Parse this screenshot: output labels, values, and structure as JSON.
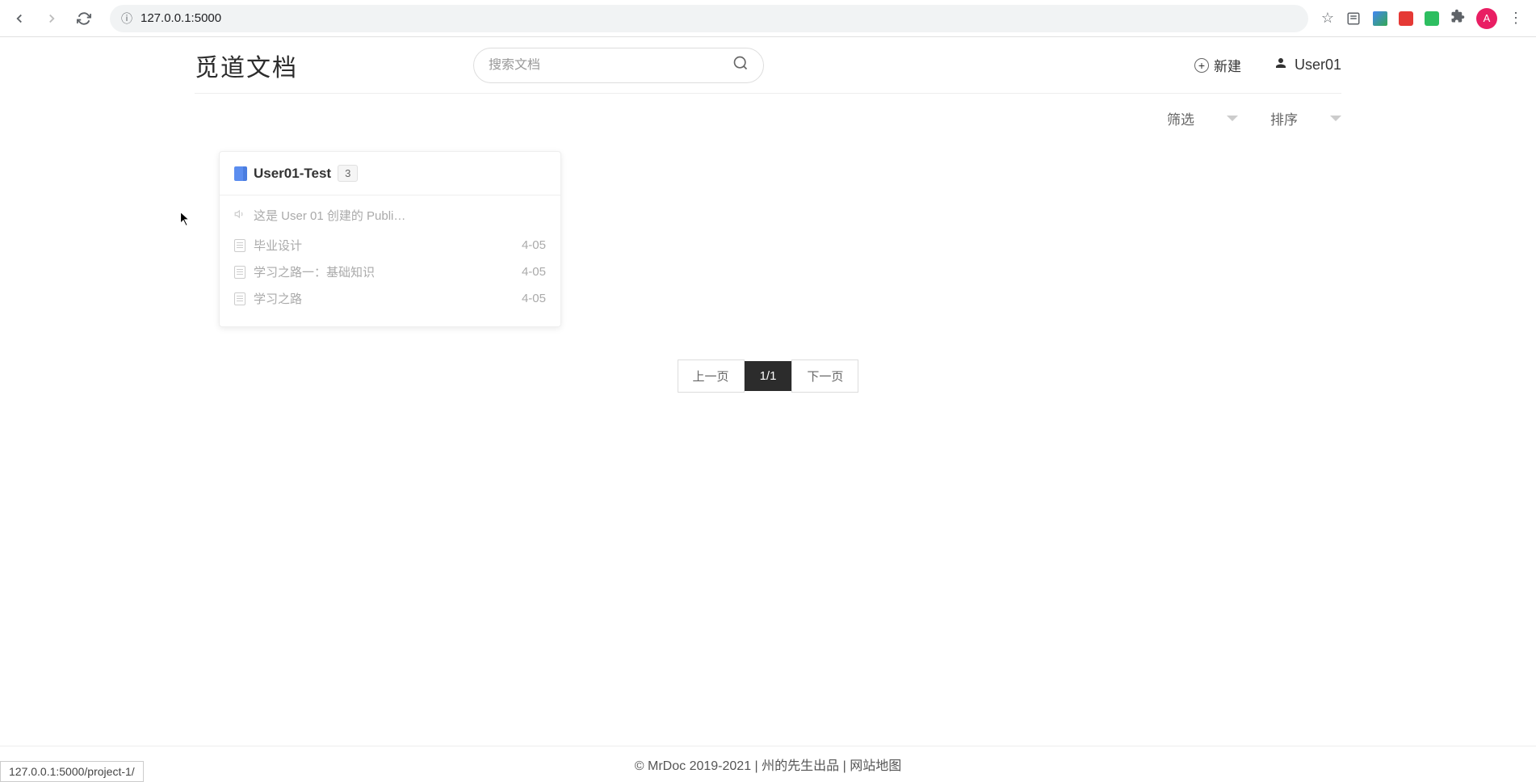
{
  "browser": {
    "url": "127.0.0.1:5000",
    "avatar_letter": "A",
    "status_url": "127.0.0.1:5000/project-1/"
  },
  "header": {
    "logo": "觅道文档",
    "search_placeholder": "搜索文档",
    "new_label": "新建",
    "username": "User01"
  },
  "filters": {
    "filter_label": "筛选",
    "sort_label": "排序"
  },
  "project": {
    "title": "User01-Test",
    "count": "3",
    "description": "这是 User 01 创建的 Publi…",
    "docs": [
      {
        "name": "毕业设计",
        "date": "4-05"
      },
      {
        "name": "学习之路一：基础知识",
        "date": "4-05"
      },
      {
        "name": "学习之路",
        "date": "4-05"
      }
    ]
  },
  "pagination": {
    "prev": "上一页",
    "current": "1/1",
    "next": "下一页"
  },
  "footer": {
    "copyright": "© MrDoc 2019-2021",
    "sep1": " | ",
    "author": "州的先生出品",
    "sep2": " | ",
    "sitemap": "网站地图"
  }
}
